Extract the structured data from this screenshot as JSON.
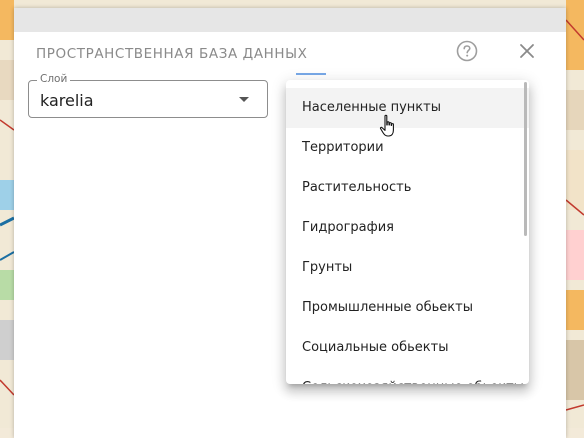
{
  "dialog": {
    "title": "ПРОСТРАНСТВЕННАЯ БАЗА ДАННЫХ",
    "help_icon": "help-circle-icon",
    "close_icon": "close-icon"
  },
  "layer_select": {
    "label": "Слой",
    "value": "karelia",
    "arrow_icon": "dropdown-arrow-icon"
  },
  "dropdown": {
    "items": [
      {
        "label": "Населенные пункты",
        "hovered": true
      },
      {
        "label": "Территории"
      },
      {
        "label": "Растительность"
      },
      {
        "label": "Гидрография"
      },
      {
        "label": "Грунты"
      },
      {
        "label": "Промышленные обьекты"
      },
      {
        "label": "Социальные обьекты"
      },
      {
        "label": "Сельскохозяйственные обьекты"
      }
    ]
  },
  "colors": {
    "accent": "#1e6fd9",
    "title_gray": "#8a8a8a",
    "hover_bg": "#f3f3f3"
  }
}
